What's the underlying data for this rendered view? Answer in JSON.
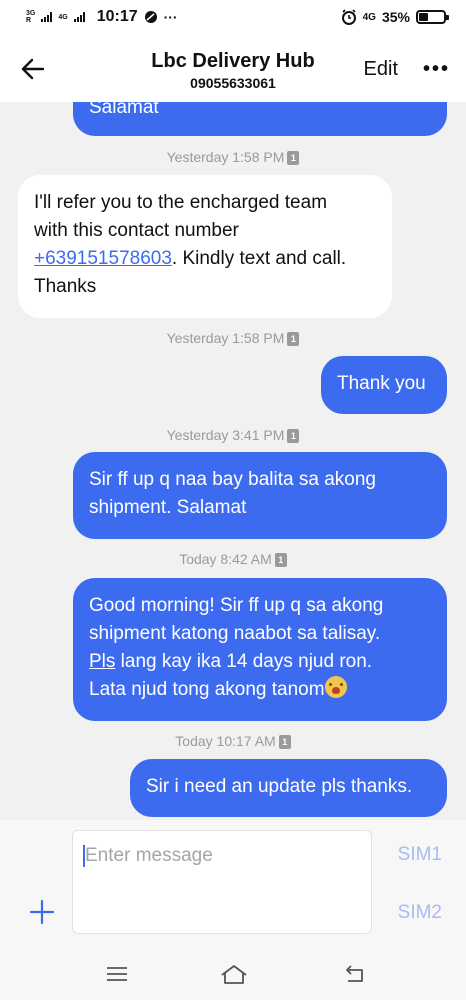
{
  "status": {
    "net_left_top": "3G",
    "net_left_bottom": "R",
    "net_right_top": "4G",
    "time": "10:17",
    "overflow": "···",
    "net_4g": "4G",
    "battery_pct": "35%",
    "battery_level": 0.35
  },
  "header": {
    "title": "Lbc Delivery Hub",
    "phone": "09055633061",
    "edit_label": "Edit",
    "more_label": "•••"
  },
  "messages": {
    "m1": {
      "text": "Salamat"
    },
    "t1": "Yesterday 1:58 PM",
    "m2": {
      "line1": "I'll refer you to the encharged team",
      "line2": "with this contact number",
      "link": "+639151578603",
      "after_link": ". Kindly text and call.",
      "line4": "Thanks"
    },
    "t2": "Yesterday 1:58 PM",
    "m3": {
      "text": "Thank you"
    },
    "t3": "Yesterday 3:41 PM",
    "m4": {
      "line1": "Sir ff up q naa bay balita sa akong",
      "line2": "shipment. Salamat"
    },
    "t4": "Today 8:42 AM",
    "m5": {
      "line1": "Good morning! Sir ff up q sa akong",
      "line2": "shipment katong naabot sa talisay.",
      "line3_u": "Pls",
      "line3_rest": " lang kay ika 14 days njud ron.",
      "line4": "Lata njud tong akong tanom"
    },
    "t5": "Today 10:17 AM",
    "m6": {
      "text": "Sir i need an update pls thanks."
    },
    "sim_badge": "1"
  },
  "composer": {
    "placeholder": "Enter message",
    "sim1_label": "SIM1",
    "sim2_label": "SIM2"
  },
  "colors": {
    "accent": "#3d6bf0",
    "bubble_in": "#ffffff",
    "background": "#f1f1f1"
  }
}
